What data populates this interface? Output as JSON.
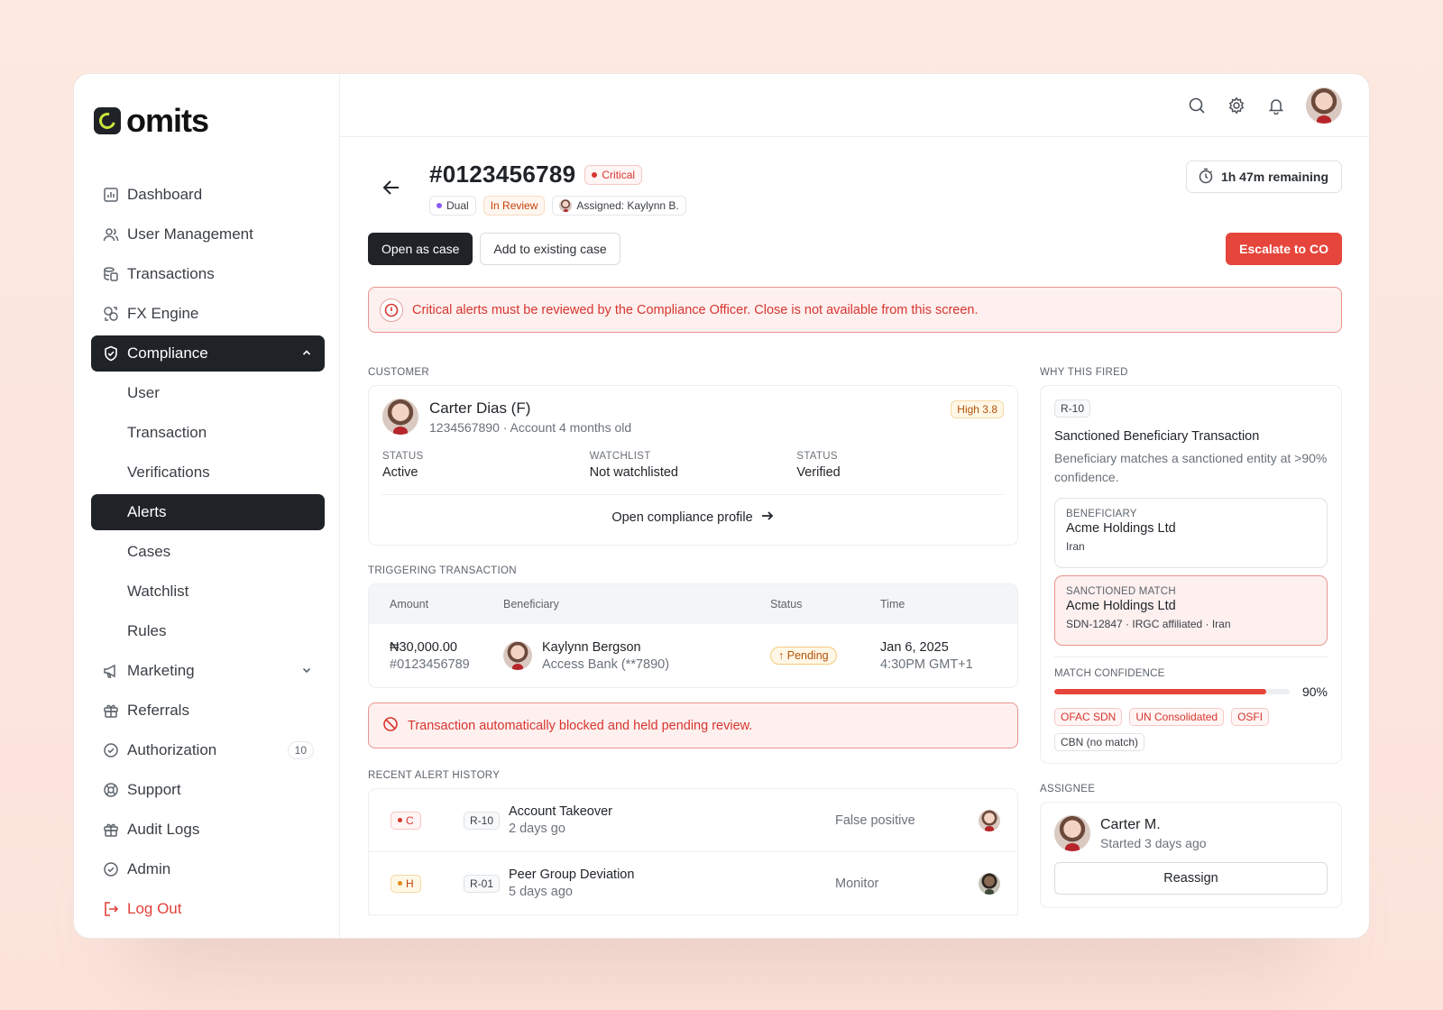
{
  "brand": {
    "name": "omits"
  },
  "sidebar": {
    "items": [
      {
        "label": "Dashboard",
        "icon": "chart-icon"
      },
      {
        "label": "User Management",
        "icon": "users-icon"
      },
      {
        "label": "Transactions",
        "icon": "coins-icon"
      },
      {
        "label": "FX Engine",
        "icon": "exchange-icon"
      },
      {
        "label": "Compliance",
        "icon": "shield-check-icon",
        "expanded": true
      },
      {
        "label": "User"
      },
      {
        "label": "Transaction"
      },
      {
        "label": "Verifications"
      },
      {
        "label": "Alerts",
        "active": true
      },
      {
        "label": "Cases"
      },
      {
        "label": "Watchlist"
      },
      {
        "label": "Rules"
      },
      {
        "label": "Marketing",
        "icon": "megaphone-icon"
      },
      {
        "label": "Referrals",
        "icon": "gift-icon"
      },
      {
        "label": "Authorization",
        "icon": "check-circle-icon",
        "count": "10"
      },
      {
        "label": "Support",
        "icon": "lifebuoy-icon"
      },
      {
        "label": "Audit Logs",
        "icon": "gift-icon"
      },
      {
        "label": "Admin",
        "icon": "check-circle-icon"
      },
      {
        "label": "Log Out",
        "icon": "logout-icon"
      }
    ]
  },
  "alert": {
    "id": "#0123456789",
    "severity": "Critical",
    "type": "Dual",
    "status": "In Review",
    "assigned": "Assigned: Kaylynn B.",
    "timer": "1h 47m remaining"
  },
  "actions": {
    "open_case": "Open as case",
    "add_case": "Add to existing case",
    "escalate": "Escalate to CO"
  },
  "banner": "Critical alerts must be reviewed by the Compliance Officer. Close is not available from this screen.",
  "customer": {
    "section": "CUSTOMER",
    "name": "Carter Dias (F)",
    "sub": "1234567890 · Account 4 months old",
    "risk": "High 3.8",
    "stats": [
      {
        "k": "STATUS",
        "v": "Active"
      },
      {
        "k": "WATCHLIST",
        "v": "Not watchlisted"
      },
      {
        "k": "STATUS",
        "v": "Verified"
      }
    ],
    "profile_link": "Open compliance profile"
  },
  "transaction": {
    "section": "TRIGGERING TRANSACTION",
    "headers": [
      "Amount",
      "Beneficiary",
      "Status",
      "Time"
    ],
    "amount": "₦30,000.00",
    "ref": "#0123456789",
    "beneficiary": "Kaylynn Bergson",
    "bank": "Access Bank (**7890)",
    "status": "Pending",
    "date": "Jan 6, 2025",
    "time": "4:30PM GMT+1"
  },
  "blocked": "Transaction automatically blocked and held pending review.",
  "history": {
    "section": "RECENT ALERT HISTORY",
    "rows": [
      {
        "sev": "C",
        "rule": "R-10",
        "title": "Account Takeover",
        "when": "2 days go",
        "outcome": "False positive"
      },
      {
        "sev": "H",
        "rule": "R-01",
        "title": "Peer Group Deviation",
        "when": "5 days ago",
        "outcome": "Monitor"
      }
    ]
  },
  "why": {
    "section": "WHY THIS FIRED",
    "rule": "R-10",
    "title": "Sanctioned Beneficiary Transaction",
    "desc": "Beneficiary matches a sanctioned entity at >90% confidence.",
    "beneficiary": {
      "k": "BENEFICIARY",
      "name": "Acme Holdings Ltd",
      "sub": "Iran"
    },
    "match": {
      "k": "SANCTIONED MATCH",
      "name": "Acme Holdings Ltd",
      "sub": "SDN-12847 · IRGC affiliated · Iran"
    },
    "confidence_label": "MATCH CONFIDENCE",
    "confidence": 90,
    "confidence_text": "90%",
    "lists": [
      "OFAC SDN",
      "UN Consolidated",
      "OSFI",
      "CBN (no match)"
    ]
  },
  "assignee": {
    "section": "ASSIGNEE",
    "name": "Carter M.",
    "sub": "Started 3 days ago",
    "reassign": "Reassign"
  }
}
